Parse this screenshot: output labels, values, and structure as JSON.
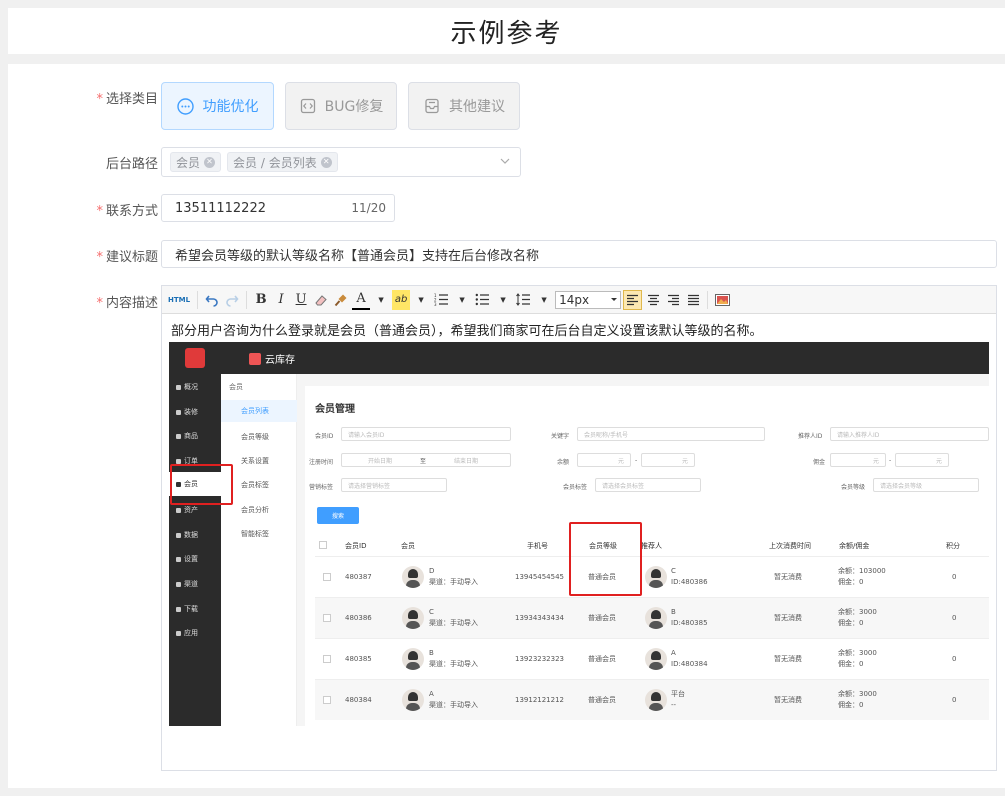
{
  "page_title": "示例参考",
  "form": {
    "category": {
      "label": "选择类目",
      "options": [
        {
          "label": "功能优化",
          "icon": "chat-bubble-icon",
          "active": true
        },
        {
          "label": "BUG修复",
          "icon": "code-icon",
          "active": false
        },
        {
          "label": "其他建议",
          "icon": "inbox-icon",
          "active": false
        }
      ]
    },
    "path": {
      "label": "后台路径",
      "tags": [
        "会员",
        "会员 / 会员列表"
      ]
    },
    "contact": {
      "label": "联系方式",
      "value": "13511112222",
      "counter": "11/20"
    },
    "suggestion_title": {
      "label": "建议标题",
      "value": "希望会员等级的默认等级名称【普通会员】支持在后台修改名称"
    },
    "content": {
      "label": "内容描述",
      "toolbar": {
        "html_label": "HTML",
        "bold": "B",
        "italic": "I",
        "underline": "U",
        "font_color": "A",
        "bg_color": "ab",
        "font_size": "14px"
      },
      "text": "部分用户咨询为什么登录就是会员（普通会员），希望我们商家可在后台自定义设置该默认等级的名称。"
    }
  },
  "screenshot": {
    "brand": "云库存",
    "nav": [
      "概况",
      "装修",
      "商品",
      "订单",
      "会员",
      "资产",
      "数据",
      "设置",
      "渠道",
      "下载",
      "应用"
    ],
    "active_nav": "会员",
    "sub_head": "会员",
    "sub_menu": [
      "会员列表",
      "会员等级",
      "关系设置",
      "会员标签",
      "会员分析",
      "智能标签"
    ],
    "active_sub": "会员列表",
    "panel_title": "会员管理",
    "filters": {
      "member_id": {
        "label": "会员ID",
        "placeholder": "请输入会员ID"
      },
      "keyword": {
        "label": "关键字",
        "placeholder": "会员昵称/手机号"
      },
      "referrer_id": {
        "label": "推荐人ID",
        "placeholder": "请输入推荐人ID"
      },
      "reg_time": {
        "label": "注册时间",
        "start": "开始日期",
        "sep": "至",
        "end": "结束日期"
      },
      "balance": {
        "label": "余额",
        "unit": "元",
        "dash": "-"
      },
      "commission": {
        "label": "佣金",
        "unit": "元",
        "dash": "-"
      },
      "tag": {
        "label": "营销标签",
        "placeholder": "请选择营销标签"
      },
      "member_tag": {
        "label": "会员标签",
        "placeholder": "请选择会员标签"
      },
      "level": {
        "label": "会员等级",
        "placeholder": "请选择会员等级"
      }
    },
    "search_button": "搜索",
    "columns": [
      "会员ID",
      "会员",
      "手机号",
      "会员等级",
      "推荐人",
      "上次消费时间",
      "余额/佣金",
      "积分"
    ],
    "rows": [
      {
        "id": "480387",
        "name": "D",
        "source": "渠道：手动导入",
        "phone": "13945454545",
        "level": "普通会员",
        "ref_name": "C",
        "ref_id": "ID:480386",
        "last": "暂无消费",
        "balance": "余额：103000",
        "commission": "佣金：0",
        "points": "0"
      },
      {
        "id": "480386",
        "name": "C",
        "source": "渠道：手动导入",
        "phone": "13934343434",
        "level": "普通会员",
        "ref_name": "B",
        "ref_id": "ID:480385",
        "last": "暂无消费",
        "balance": "余额：3000",
        "commission": "佣金：0",
        "points": "0"
      },
      {
        "id": "480385",
        "name": "B",
        "source": "渠道：手动导入",
        "phone": "13923232323",
        "level": "普通会员",
        "ref_name": "A",
        "ref_id": "ID:480384",
        "last": "暂无消费",
        "balance": "余额：3000",
        "commission": "佣金：0",
        "points": "0"
      },
      {
        "id": "480384",
        "name": "A",
        "source": "渠道：手动导入",
        "phone": "13912121212",
        "level": "普通会员",
        "ref_name": "平台",
        "ref_id": "--",
        "last": "暂无消费",
        "balance": "余额：3000",
        "commission": "佣金：0",
        "points": "0"
      }
    ]
  },
  "colors": {
    "accent": "#409eff",
    "required": "#f56c6c",
    "highlight": "#e02020",
    "sidebar": "#2b2b2b"
  }
}
